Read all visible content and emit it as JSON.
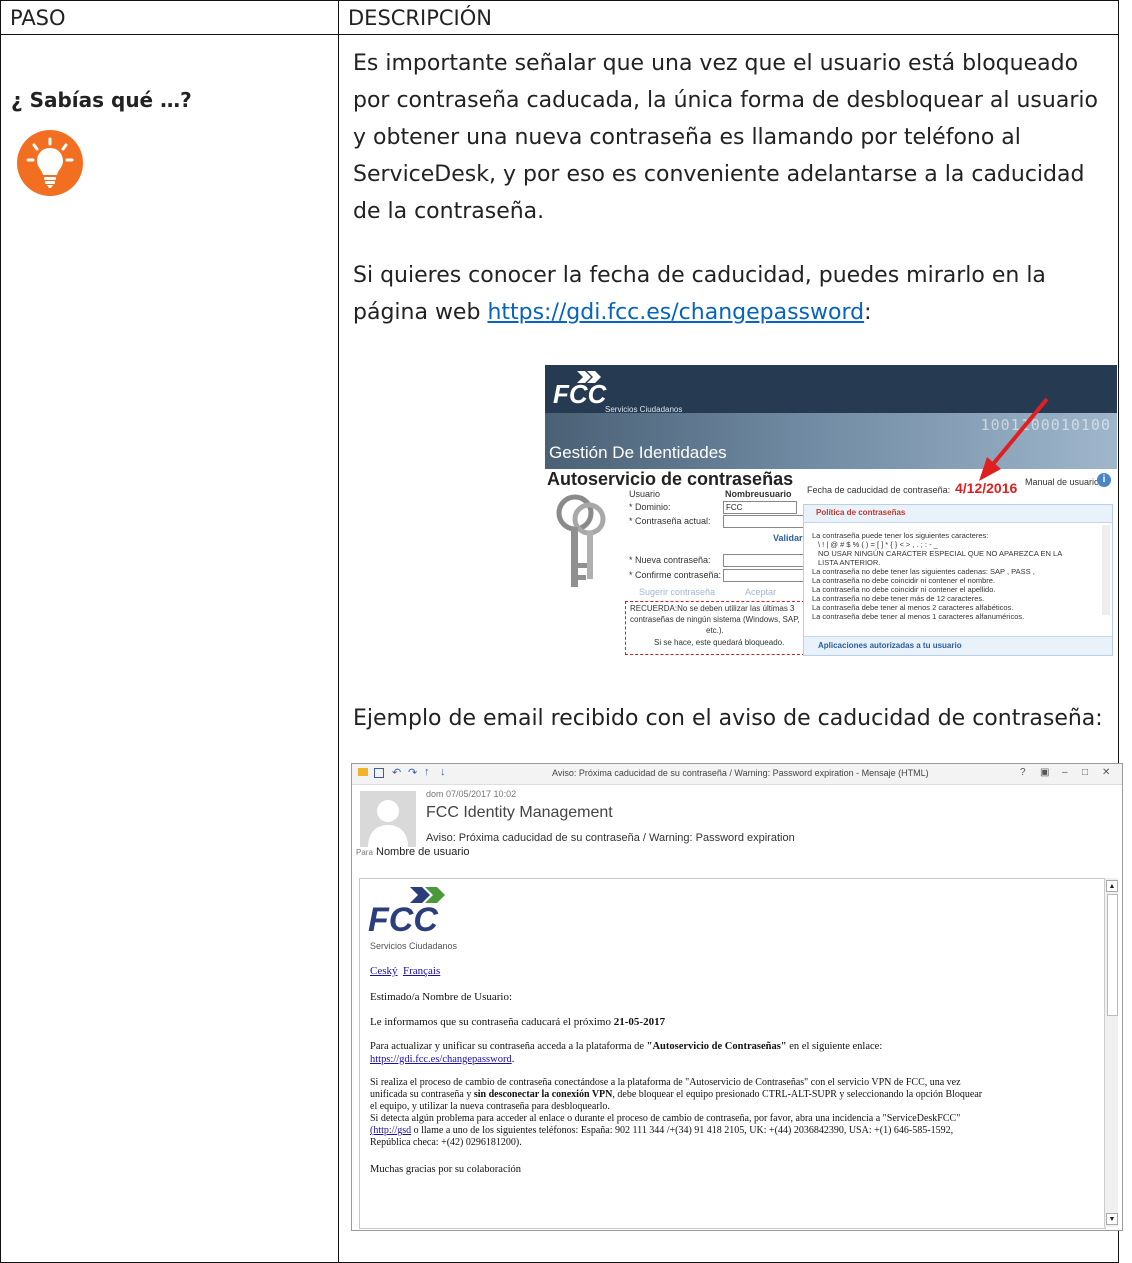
{
  "table": {
    "header_paso": "PASO",
    "header_descripcion": "DESCRIPCIÓN"
  },
  "tip": {
    "title": "¿ Sabías qué …?",
    "icon": "lightbulb-icon",
    "icon_color": "#f26f21"
  },
  "description": {
    "para1": "Es importante señalar que una vez que el usuario está bloqueado por contraseña caducada, la única forma de desbloquear al usuario y obtener una nueva contraseña es llamando por teléfono al ServiceDesk, y por eso es conveniente adelantarse a la caducidad de la contraseña.",
    "para2_prefix": "Si quieres conocer la fecha de caducidad, puedes mirarlo en la página web ",
    "para2_link": "https://gdi.fcc.es/changepassword",
    "para2_suffix": ":",
    "para3": "Ejemplo de email recibido con el aviso de caducidad de contraseña:"
  },
  "screenshot_portal": {
    "logo": "FCC",
    "logo_sub": "Servicios Ciudadanos",
    "band_bits": "1001100010100",
    "band_title": "Gestión De Identidades",
    "title": "Autoservicio de contraseñas",
    "manual_link": "Manual de usuario",
    "expiry_label": "Fecha de caducidad de contraseña:",
    "expiry_date": "4/12/2016",
    "usuario_label": "Usuario",
    "usuario_value": "Nombreusuario",
    "dominio_label": "* Dominio:",
    "dominio_value": "FCC",
    "actual_label": "* Contraseña actual:",
    "validar": "Validar",
    "nueva_label": "* Nueva contraseña:",
    "confirme_label": "* Confirme contraseña:",
    "sugerir": "Sugerir contraseña",
    "aceptar": "Aceptar",
    "recuerda_1": "RECUERDA:No se deben utilizar las últimas 3",
    "recuerda_2": "contraseñas de ningún sistema (Windows, SAP,",
    "recuerda_3": "etc.).",
    "recuerda_4": "Si se hace, este quedará bloqueado.",
    "policy_header": "Política de contraseñas",
    "policy_items": [
      "La contraseña puede tener los siguientes caracteres:",
      "\\ ! | @ # $ % ( ) = [ ] * { } < > , . ; : - _",
      "NO USAR NINGÚN CARACTER ESPECIAL QUE NO APAREZCA EN LA",
      "LISTA ANTERIOR.",
      "La contraseña no debe tener las siguientes cadenas: SAP , PASS ,",
      "La contraseña no debe coincidir ni contener el nombre.",
      "La contraseña no debe coincidir ni contener el apellido.",
      "La contraseña no debe tener más de 12 caracteres.",
      "La contraseña debe tener al menos 2 caracteres alfabéticos.",
      "La contraseña debe tener al menos 1 caracteres alfanuméricos."
    ],
    "apps_footer": "Aplicaciones autorizadas a tu usuario"
  },
  "screenshot_email": {
    "window_title": "Aviso: Próxima caducidad de su contraseña / Warning: Password expiration - Mensaje (HTML)",
    "window_controls": [
      "?",
      "▣",
      "–",
      "□",
      "✕"
    ],
    "date": "dom 07/05/2017 10:02",
    "sender": "FCC Identity Management",
    "subject": "Aviso: Próxima caducidad de su contraseña / Warning: Password expiration",
    "to_label": "Para",
    "to_value": "Nombre de usuario",
    "logo": "FCC",
    "logo_sub": "Servicios Ciudadanos",
    "lang_cz": "Ceský",
    "lang_fr": "Français",
    "greeting": "Estimado/a Nombre de Usuario:",
    "line_expiry_prefix": "Le informamos que su contraseña caducará el próximo",
    "line_expiry_date": "21-05-2017",
    "line_update_prefix": "Para actualizar y unificar su contraseña acceda a la plataforma de",
    "line_update_bold": "\"Autoservicio de Contraseñas\"",
    "line_update_suffix": "en el siguiente enlace:",
    "update_link": "https://gdi.fcc.es/changepassword",
    "update_link_suffix": ".",
    "vpn_1": "Si realiza el proceso de cambio de contraseña conectándose a la plataforma de \"Autoservicio de Contraseñas\" con el servicio VPN de FCC, una vez",
    "vpn_2_prefix": "unificada su contraseña y",
    "vpn_2_bold": "sin desconectar la conexión VPN",
    "vpn_2_suffix": ", debe bloquear el equipo presionado CTRL-ALT-SUPR y seleccionando la opción Bloquear",
    "vpn_3": "el equipo, y utilizar la nueva contraseña para desbloquearlo.",
    "problem_1": "Si detecta algún problema para acceder al enlace o durante el proceso de cambio de contraseña, por favor, abra una incidencia a \"ServiceDeskFCC\"",
    "problem_2_link": "(http://gsd",
    "problem_2_suffix": "o llame a uno de los siguientes teléfonos: España: 902 111 344 /+(34) 91 418 2105, UK: +(44) 2036842390, USA: +(1) 646-585-1592,",
    "problem_3": "República checa: +(42) 0296181200).",
    "thanks": "Muchas gracias por su colaboración"
  }
}
